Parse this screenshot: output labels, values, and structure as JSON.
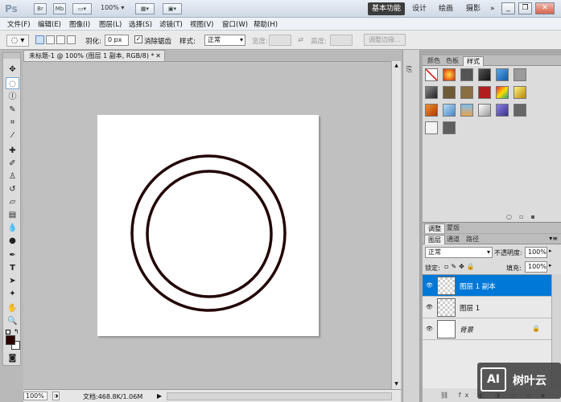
{
  "titlebar": {
    "logo": "Ps",
    "br": "Br",
    "mb": "Mb",
    "zoom": "100%",
    "workspaces": [
      "基本功能",
      "设计",
      "绘画",
      "摄影"
    ],
    "more": "»",
    "min": "_",
    "restore": "❐",
    "close": "✕"
  },
  "menu": [
    "文件(F)",
    "编辑(E)",
    "图像(I)",
    "图层(L)",
    "选择(S)",
    "滤镜(T)",
    "视图(V)",
    "窗口(W)",
    "帮助(H)"
  ],
  "options": {
    "feather_label": "羽化:",
    "feather_value": "0 px",
    "antialias": "消除锯齿",
    "style_label": "样式:",
    "style_value": "正常",
    "width_label": "宽度:",
    "height_label": "高度:",
    "refine_button": "调整边缘..."
  },
  "document": {
    "tab_title": "未标题-1 @ 100% (图层 1 副本, RGB/8) *",
    "zoom": "100%",
    "doc_info": "文档:468.8K/1.06M"
  },
  "styles_panel": {
    "tabs": [
      "颜色",
      "色板",
      "样式"
    ]
  },
  "adjust_panel": {
    "tabs": [
      "调整",
      "蒙版"
    ]
  },
  "layers_panel": {
    "tabs": [
      "图层",
      "通道",
      "路径"
    ],
    "blend_mode": "正常",
    "opacity_label": "不透明度:",
    "opacity_value": "100%",
    "lock_label": "锁定:",
    "fill_label": "填充:",
    "fill_value": "100%",
    "layers": [
      {
        "name": "图层 1 副本",
        "selected": true
      },
      {
        "name": "图层 1",
        "selected": false
      },
      {
        "name": "背景",
        "selected": false
      }
    ]
  },
  "watermark": {
    "logo": "AI",
    "text": "树叶云"
  },
  "colors": {
    "selection": "#0078d7",
    "foreground": "#2b0000",
    "ring": "#230406"
  }
}
